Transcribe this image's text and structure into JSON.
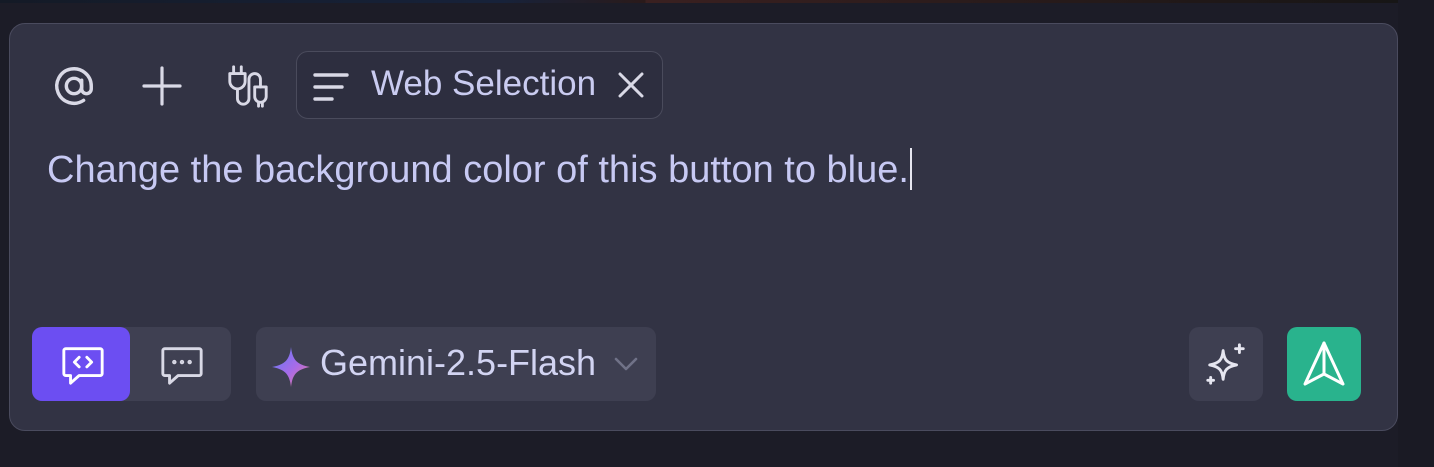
{
  "toolbar": {
    "mention_icon": "at-icon",
    "add_icon": "plus-icon",
    "plugin_icon": "plug-icon",
    "context_chip": {
      "icon": "lines-icon",
      "label": "Web Selection",
      "remove_icon": "close-icon"
    }
  },
  "input": {
    "value": "Change the background color of this button to blue."
  },
  "footer": {
    "modes": [
      {
        "name": "code-mode",
        "icon": "code-message-icon",
        "active": true
      },
      {
        "name": "chat-mode",
        "icon": "chat-dots-icon",
        "active": false
      }
    ],
    "model": {
      "icon": "sparkle-star-icon",
      "label": "Gemini-2.5-Flash",
      "dropdown_icon": "chevron-down-icon"
    },
    "enhance_icon": "sparkles-icon",
    "send_icon": "send-arrow-icon"
  },
  "colors": {
    "background": "#1c1c27",
    "panel": "#323344",
    "accent_purple": "#6c4ef2",
    "send_green": "#29b38d",
    "text": "#c7c9f3"
  }
}
